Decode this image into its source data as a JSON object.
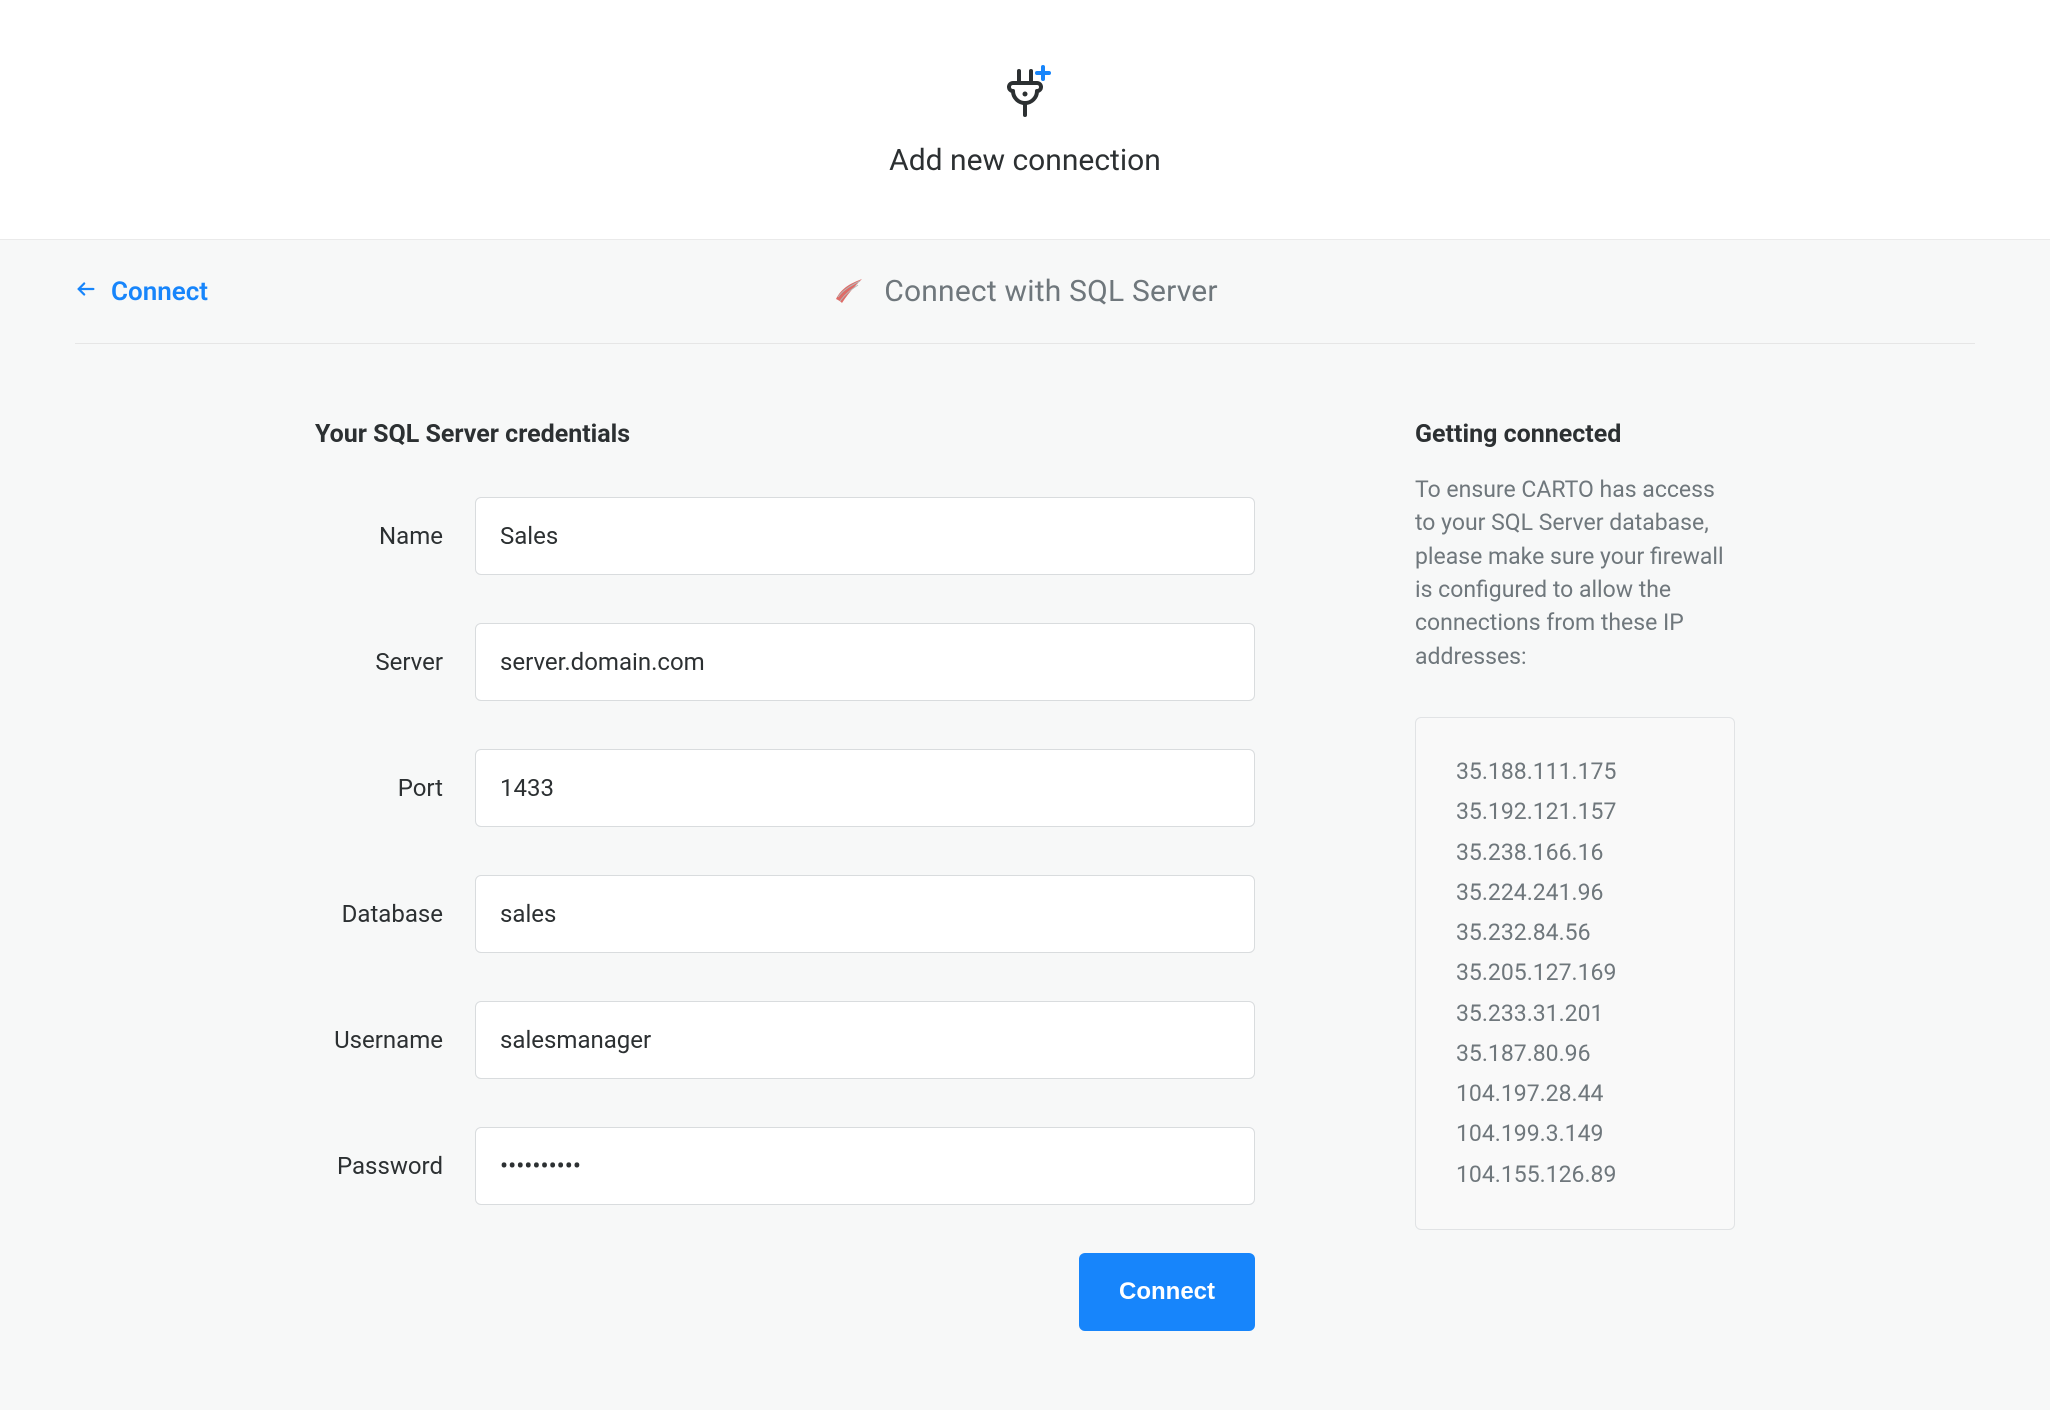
{
  "header": {
    "title": "Add new connection"
  },
  "subbar": {
    "back_label": "Connect",
    "title": "Connect with SQL Server"
  },
  "form": {
    "section_title": "Your SQL Server credentials",
    "fields": {
      "name": {
        "label": "Name",
        "value": "Sales"
      },
      "server": {
        "label": "Server",
        "value": "server.domain.com"
      },
      "port": {
        "label": "Port",
        "value": "1433"
      },
      "database": {
        "label": "Database",
        "value": "sales"
      },
      "username": {
        "label": "Username",
        "value": "salesmanager"
      },
      "password": {
        "label": "Password",
        "value": "••••••••••"
      }
    },
    "submit_label": "Connect"
  },
  "side": {
    "title": "Getting connected",
    "help_text": "To ensure CARTO has access to your SQL Server database, please make sure your firewall is configured to allow the connections from these IP addresses:",
    "ips": [
      "35.188.111.175",
      "35.192.121.157",
      "35.238.166.16",
      "35.224.241.96",
      "35.232.84.56",
      "35.205.127.169",
      "35.233.31.201",
      "35.187.80.96",
      "104.197.28.44",
      "104.199.3.149",
      "104.155.126.89"
    ]
  }
}
